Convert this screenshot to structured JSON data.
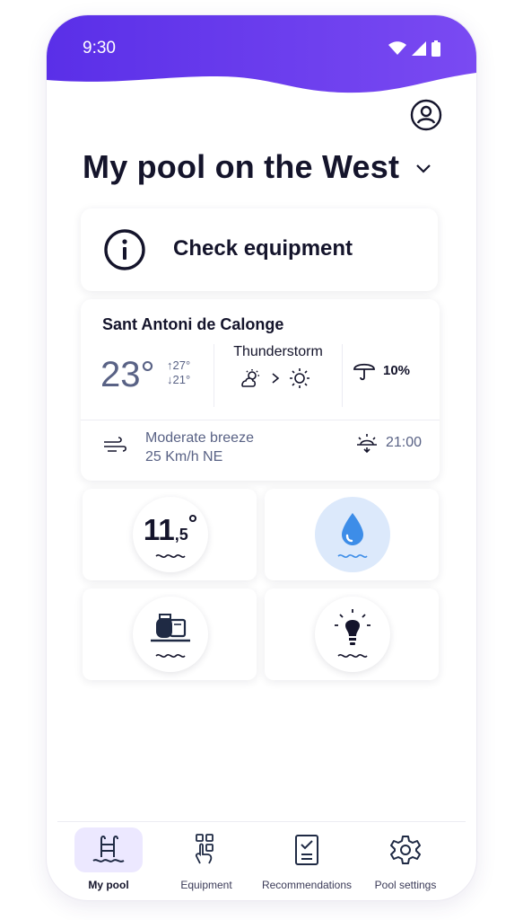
{
  "status_bar": {
    "time": "9:30",
    "accent_color": "#6a3df0"
  },
  "header": {
    "title": "My pool on the West",
    "profile_icon": "user-circle-icon",
    "dropdown_icon": "chevron-down-icon"
  },
  "alert": {
    "label": "Check equipment",
    "icon": "info-circle-icon"
  },
  "weather": {
    "location": "Sant Antoni de Calonge",
    "current_temp": "23°",
    "max_temp": "↑27°",
    "min_temp": "↓21°",
    "forecast": "Thunderstorm",
    "forecast_from_icon": "partly-cloudy-icon",
    "forecast_to_icon": "sun-icon",
    "rain_probability": "10%",
    "wind_description": "Moderate breeze",
    "wind_speed": "25 Km/h NE",
    "sunset_time": "21:00"
  },
  "tiles": {
    "water_temp_int": "11",
    "water_temp_dec": ",5",
    "water_temp_unit": "°",
    "water_level_icon": "water-drop-icon",
    "filter_icon": "pump-filter-icon",
    "lighting_icon": "light-bulb-icon"
  },
  "nav": {
    "items": [
      {
        "label": "My pool",
        "icon": "pool-ladder-icon",
        "active": true
      },
      {
        "label": "Equipment",
        "icon": "equipment-touch-icon",
        "active": false
      },
      {
        "label": "Recommendations",
        "icon": "checklist-icon",
        "active": false
      },
      {
        "label": "Pool settings",
        "icon": "gear-icon",
        "active": false
      }
    ]
  },
  "colors": {
    "primary_purple": "#6a3df0",
    "text_dark": "#14142b",
    "muted": "#596285",
    "drop_blue": "#3d8de8",
    "active_tile_bg": "#dce9fb",
    "nav_active_bg": "#ece8ff"
  }
}
